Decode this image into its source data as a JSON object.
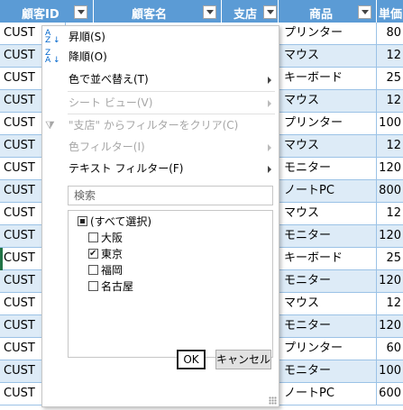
{
  "headers": [
    {
      "label": "顧客ID"
    },
    {
      "label": "顧客名"
    },
    {
      "label": "支店"
    },
    {
      "label": "商品"
    },
    {
      "label": "単価"
    }
  ],
  "rows": [
    {
      "id": "CUST",
      "product": "プリンター",
      "price": "80"
    },
    {
      "id": "CUST",
      "product": "マウス",
      "price": "12"
    },
    {
      "id": "CUST",
      "product": "キーボード",
      "price": "25"
    },
    {
      "id": "CUST",
      "product": "マウス",
      "price": "12"
    },
    {
      "id": "CUST",
      "product": "プリンター",
      "price": "100"
    },
    {
      "id": "CUST",
      "product": "マウス",
      "price": "12"
    },
    {
      "id": "CUST",
      "product": "モニター",
      "price": "120"
    },
    {
      "id": "CUST",
      "product": "ノートPC",
      "price": "800"
    },
    {
      "id": "CUST",
      "product": "マウス",
      "price": "12"
    },
    {
      "id": "CUST",
      "product": "モニター",
      "price": "120"
    },
    {
      "id": "CUST",
      "product": "キーボード",
      "price": "25"
    },
    {
      "id": "CUST",
      "product": "モニター",
      "price": "120"
    },
    {
      "id": "CUST",
      "product": "マウス",
      "price": "12"
    },
    {
      "id": "CUST",
      "product": "モニター",
      "price": "120"
    },
    {
      "id": "CUST",
      "product": "プリンター",
      "price": "60"
    },
    {
      "id": "CUST",
      "product": "モニター",
      "price": "100"
    },
    {
      "id": "CUST",
      "product": "ノートPC",
      "price": "600"
    }
  ],
  "menu": {
    "sort_asc": "昇順(S)",
    "sort_desc": "降順(O)",
    "sort_by_color": "色で並べ替え(T)",
    "sheet_view": "シート ビュー(V)",
    "clear_filter": "\"支店\" からフィルターをクリア(C)",
    "color_filter": "色フィルター(I)",
    "text_filter": "テキスト フィルター(F)",
    "search_placeholder": "検索",
    "items": [
      {
        "label": "(すべて選択)",
        "state": "mixed"
      },
      {
        "label": "大阪",
        "state": "off"
      },
      {
        "label": "東京",
        "state": "on"
      },
      {
        "label": "福岡",
        "state": "off"
      },
      {
        "label": "名古屋",
        "state": "off"
      }
    ],
    "ok": "OK",
    "cancel": "キャンセル"
  },
  "icons": {
    "sort_asc": "sort-ascending-icon",
    "sort_desc": "sort-descending-icon",
    "clear_filter": "clear-filter-icon"
  },
  "colors": {
    "header_bg": "#5b9bd5",
    "band": "#ddebf7",
    "grid": "#9bc2e6"
  }
}
